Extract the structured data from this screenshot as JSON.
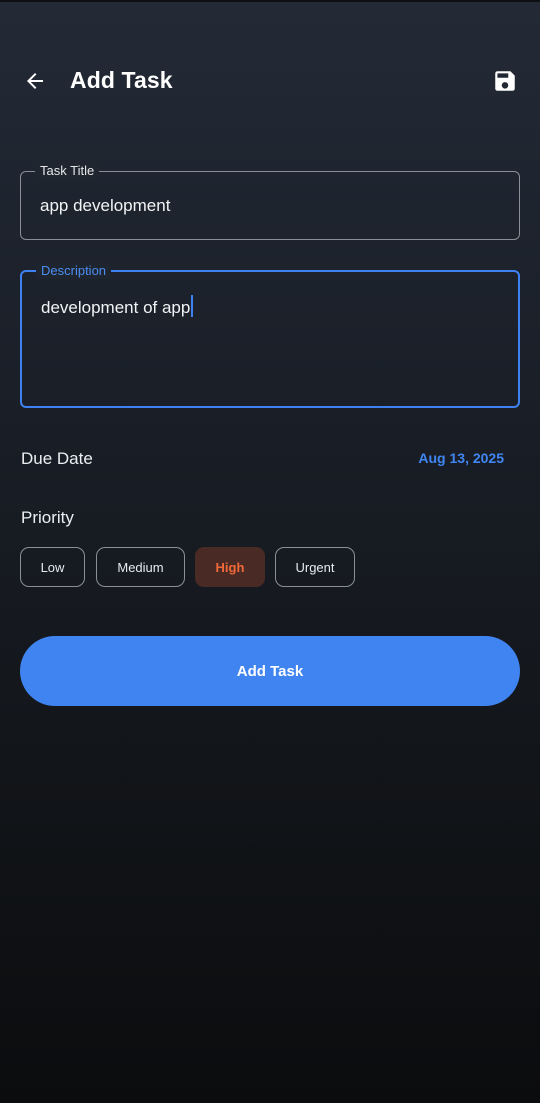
{
  "header": {
    "title": "Add Task",
    "back_icon": "arrow-left-icon",
    "save_icon": "floppy-disk-icon"
  },
  "form": {
    "title_field": {
      "label": "Task Title",
      "value": "app development"
    },
    "description_field": {
      "label": "Description",
      "value": "development of app"
    },
    "due_date": {
      "label": "Due Date",
      "value": "Aug 13, 2025"
    },
    "priority": {
      "label": "Priority",
      "options": [
        "Low",
        "Medium",
        "High",
        "Urgent"
      ],
      "selected": "High"
    },
    "submit_label": "Add Task"
  },
  "colors": {
    "accent": "#3f84f1",
    "selected_chip_bg": "#4a2a24",
    "selected_chip_text": "#f06a3a"
  }
}
